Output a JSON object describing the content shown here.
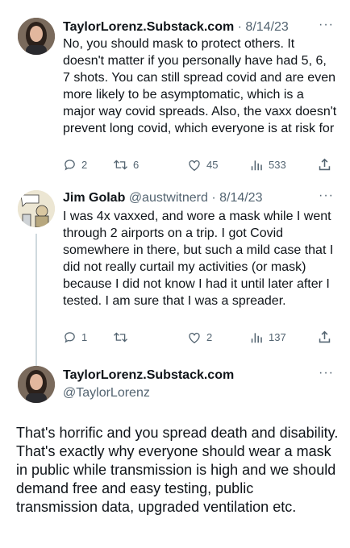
{
  "tweets": [
    {
      "display_name": "TaylorLorenz.Substack.com",
      "date": "8/14/23",
      "text": "No, you should mask to protect others. It doesn't matter if you personally have had 5, 6, 7 shots. You can still spread covid and are even more likely to be asymptomatic, which is a major way covid spreads. Also, the vaxx doesn't prevent long covid, which everyone is at risk for",
      "replies": "2",
      "retweets": "6",
      "likes": "45",
      "views": "533"
    },
    {
      "display_name": "Jim Golab",
      "handle": "@austwitnerd",
      "date": "8/14/23",
      "text": "I was 4x vaxxed, and wore a mask while I went through 2 airports on a trip. I got Covid somewhere in there, but such a mild case that I did not really curtail my activities (or mask) because I did not know I had it until later after I tested. I am sure that I was a spreader.",
      "replies": "1",
      "retweets": "",
      "likes": "2",
      "views": "137"
    },
    {
      "display_name": "TaylorLorenz.Substack.com",
      "handle": "@TaylorLorenz",
      "text": "That's horrific and you spread death and disability. That's exactly why everyone should wear a mask in public while transmission is high and we should demand free and easy testing, public transmission data, upgraded ventilation etc."
    }
  ],
  "ui": {
    "more": "···",
    "separator": " · "
  },
  "colors": {
    "muted": "#536471",
    "text": "#0f1419",
    "thread_line": "#cfd9de"
  },
  "icons": [
    "reply-icon",
    "retweet-icon",
    "like-icon",
    "views-icon",
    "share-icon",
    "more-icon"
  ]
}
